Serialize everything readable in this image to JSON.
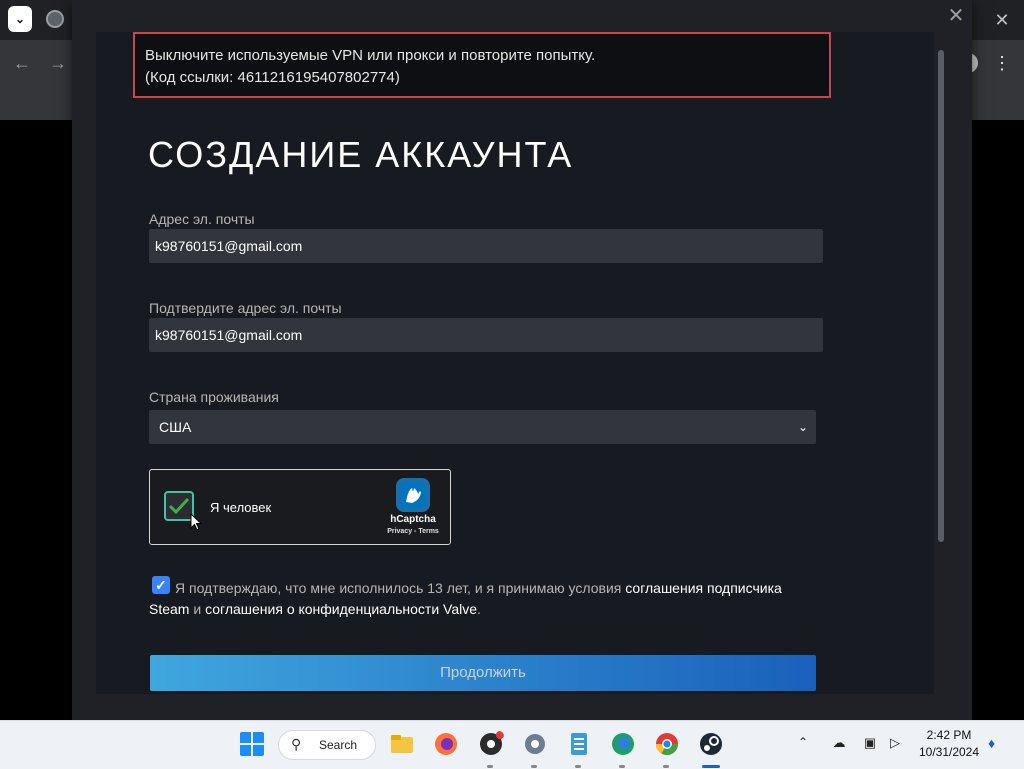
{
  "browser": {
    "tab_menu_icon": "chevron-down-icon",
    "tab_icon": "globe-icon",
    "close_icon": "close-icon",
    "back_icon": "arrow-left-icon",
    "forward_icon": "arrow-right-icon",
    "menu_icon": "more-vert-icon"
  },
  "modal": {
    "close_icon": "close-icon"
  },
  "error": {
    "line1": "Выключите используемые VPN или прокси и повторите попытку.",
    "line2": "(Код ссылки: 4611216195407802774)",
    "border_color": "#c9474b"
  },
  "form": {
    "title": "СОЗДАНИЕ АККАУНТА",
    "email_label": "Адрес эл. почты",
    "email_value": "k98760151@gmail.com",
    "confirm_label": "Подтвердите адрес эл. почты",
    "confirm_value": "k98760151@gmail.com",
    "country_label": "Страна проживания",
    "country_value": "США",
    "captcha": {
      "label": "Я человек",
      "brand": "hCaptcha",
      "links": "Privacy - Terms",
      "checked": true
    },
    "agree": {
      "checked": true,
      "text_before": "Я подтверждаю, что мне исполнилось 13 лет, и я принимаю условия ",
      "link1": "соглашения подписчика Steam",
      "text_mid": " и ",
      "link2": "соглашения о конфиденциальности Valve",
      "text_after": "."
    },
    "continue_label": "Продолжить"
  },
  "taskbar": {
    "search_label": "Search",
    "time": "2:42 PM",
    "date": "10/31/2024",
    "apps": [
      "start-icon",
      "file-explorer-icon",
      "firefox-icon",
      "obs-icon",
      "settings-icon",
      "notepad-icon",
      "edge-icon",
      "chrome-icon",
      "steam-icon"
    ]
  },
  "colors": {
    "accent": "#1a6dd6",
    "background": "#181a21"
  }
}
